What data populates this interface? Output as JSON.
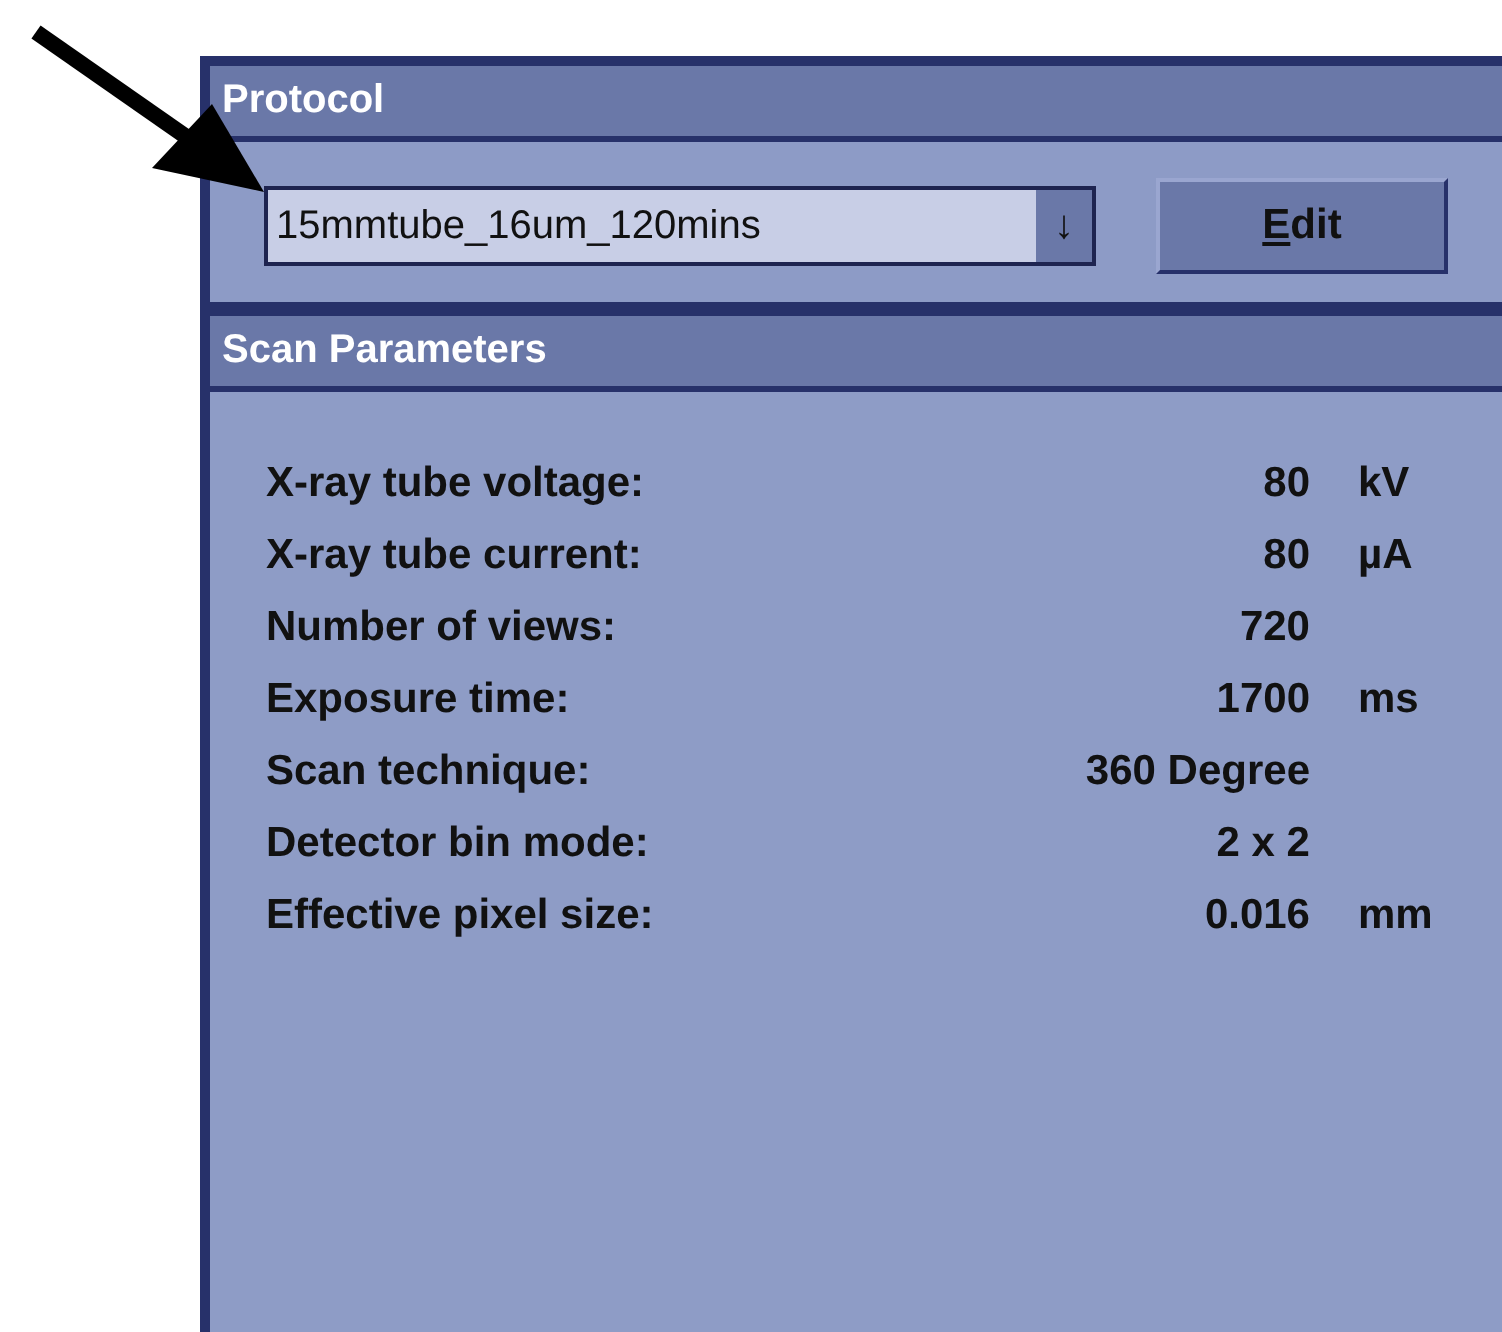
{
  "protocol": {
    "title": "Protocol",
    "selection": "15mmtube_16um_120mins",
    "dropdown_arrow": "↓",
    "edit_button": "Edit"
  },
  "scan_parameters": {
    "title": "Scan Parameters",
    "rows": [
      {
        "label": "X-ray tube voltage:",
        "value": "80",
        "unit": "kV"
      },
      {
        "label": "X-ray tube current:",
        "value": "80",
        "unit": "µA"
      },
      {
        "label": "Number of views:",
        "value": "720"
      },
      {
        "label": "Exposure time:",
        "value": "1700",
        "unit": "ms"
      },
      {
        "label": "Scan technique:",
        "value": "360 Degree"
      },
      {
        "label": "Detector bin mode:",
        "value": "2 x 2"
      },
      {
        "label": "Effective pixel size:",
        "value": "0.016",
        "unit": "mm"
      }
    ]
  }
}
